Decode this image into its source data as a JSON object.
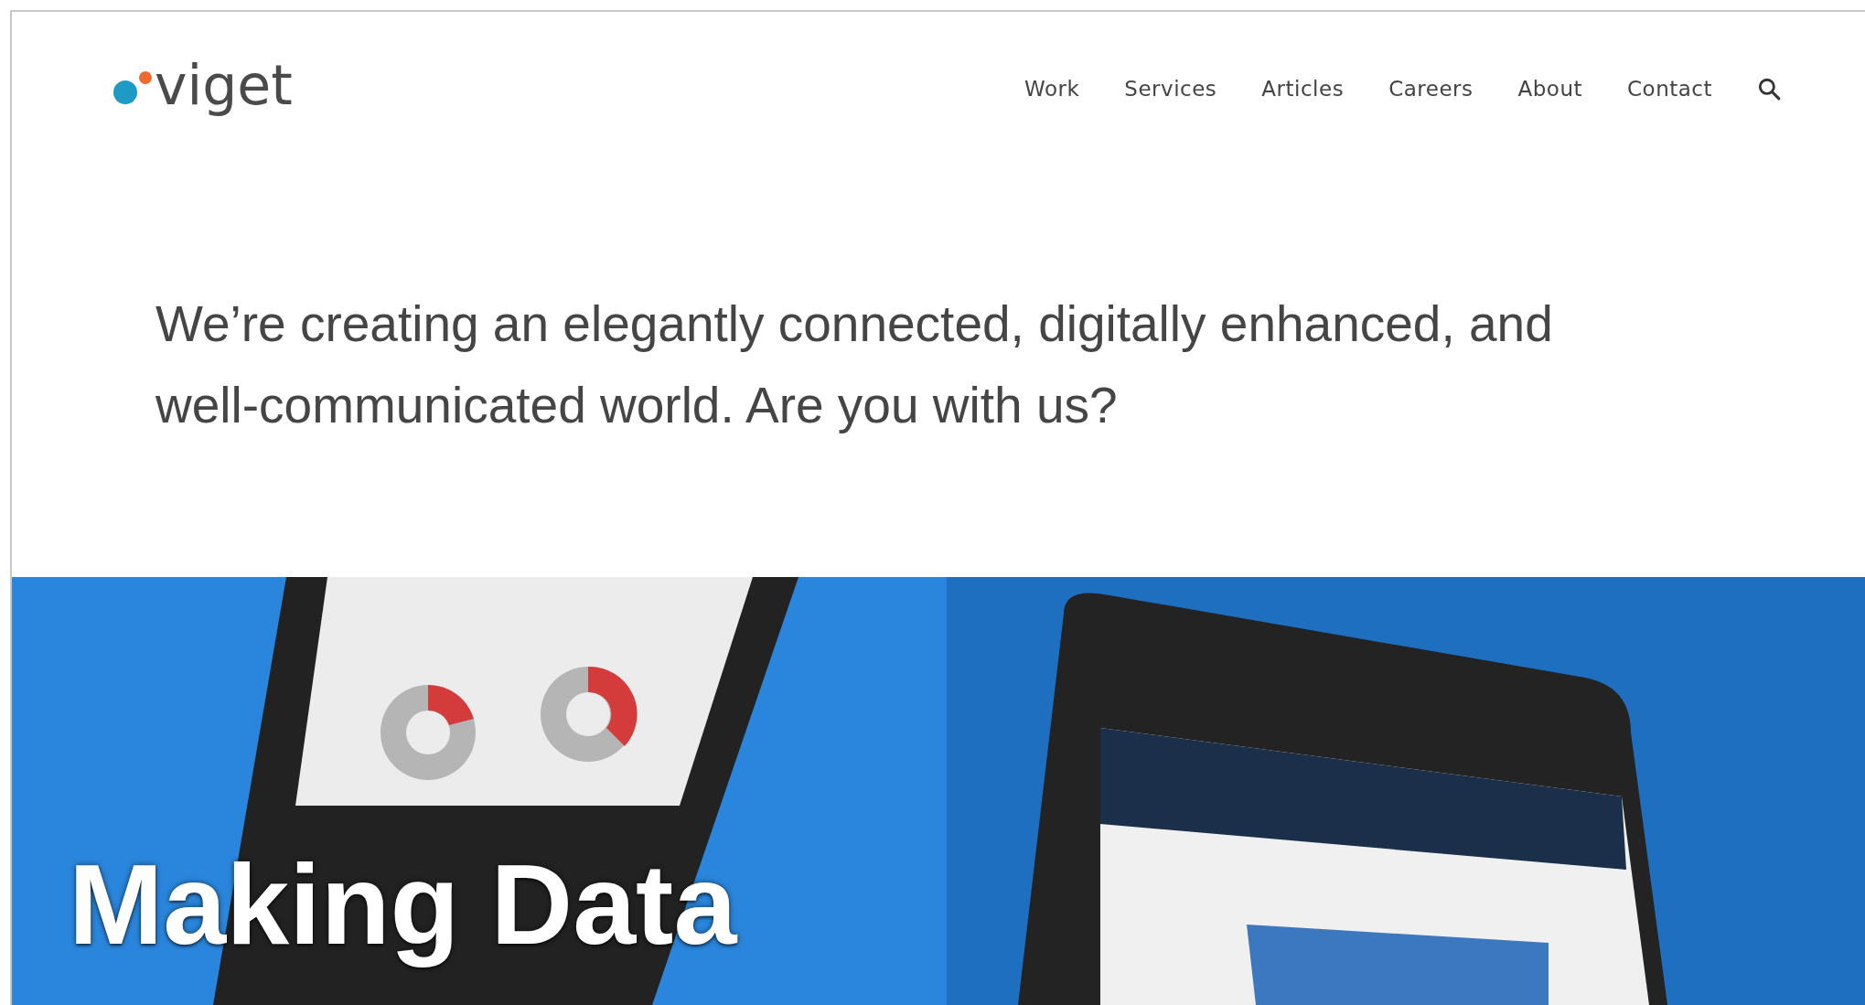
{
  "logo": {
    "text": "viget"
  },
  "nav": [
    {
      "label": "Work"
    },
    {
      "label": "Services"
    },
    {
      "label": "Articles"
    },
    {
      "label": "Careers"
    },
    {
      "label": "About"
    },
    {
      "label": "Contact"
    }
  ],
  "hero": {
    "text": "We’re creating an elegantly connected, digitally enhanced, and well-communicated world. Are you with us?"
  },
  "feature": {
    "kind": "picture",
    "title": "Making Data"
  }
}
